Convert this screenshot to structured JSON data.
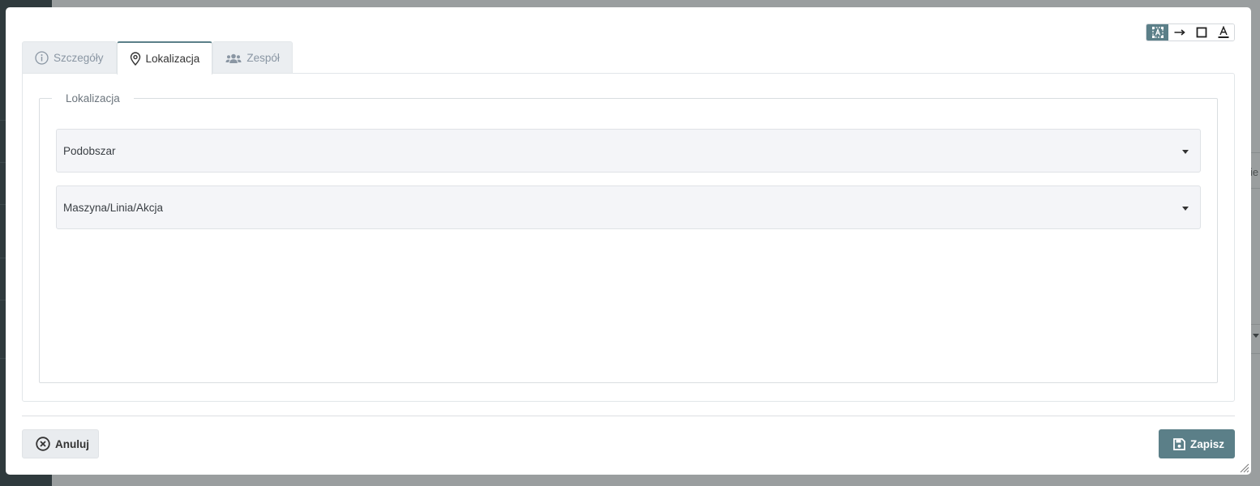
{
  "background": {
    "right_edge_text": "ie"
  },
  "toolbar": {
    "tools": [
      {
        "icon": "text-select-icon",
        "active": true
      },
      {
        "icon": "arrow-right-icon",
        "active": false
      },
      {
        "icon": "square-icon",
        "active": false
      },
      {
        "icon": "text-color-icon",
        "active": false
      }
    ]
  },
  "tabs": [
    {
      "label": "Szczegóły",
      "icon": "info-circle-icon",
      "active": false
    },
    {
      "label": "Lokalizacja",
      "icon": "map-marker-icon",
      "active": true
    },
    {
      "label": "Zespół",
      "icon": "users-icon",
      "active": false
    }
  ],
  "location": {
    "legend": "Lokalizacja",
    "subarea_placeholder": "Podobszar",
    "machine_placeholder": "Maszyna/Linia/Akcja"
  },
  "footer": {
    "cancel_label": "Anuluj",
    "save_label": "Zapisz"
  },
  "colors": {
    "accent": "#5b7f88",
    "tab_inactive_text": "#8a96a3",
    "select_bg": "#f4f5f8"
  }
}
